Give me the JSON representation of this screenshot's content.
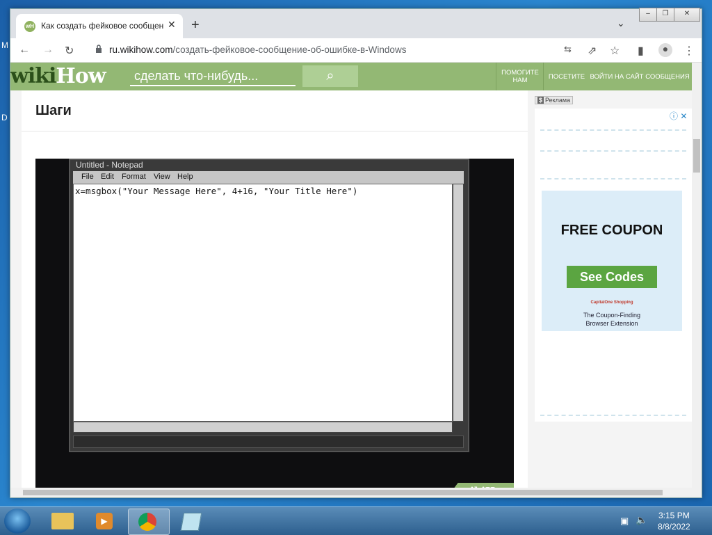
{
  "desktop": {
    "edge_top": "M",
    "edge_mid": "D"
  },
  "browser": {
    "tab_title": "Как создать фейковое сообщение",
    "tab_close": "✕",
    "new_tab": "+",
    "tab_search": "⌄",
    "window_controls": {
      "minimize": "–",
      "maximize": "❐",
      "close": "✕"
    },
    "url_host": "ru.wikihow.com",
    "url_path": "/создать-фейковое-сообщение-об-ошибке-в-Windows"
  },
  "wikihow": {
    "logo_wiki": "wiki",
    "logo_how": "How",
    "search_placeholder": "сделать что-нибудь...",
    "nav": [
      "ПОМОГИТЕ НАМ",
      "ПОСЕТИТЕ",
      "ВОЙТИ НА САЙТ",
      "СООБЩЕНИЯ"
    ],
    "section_title": "Шаги",
    "watermark": "wikiHow"
  },
  "notepad": {
    "title": "Untitled - Notepad",
    "menu": [
      "File",
      "Edit",
      "Format",
      "View",
      "Help"
    ],
    "content": "x=msgbox(\"Your Message Here\", 4+16, \"Your Title Here\")"
  },
  "ad": {
    "label_icon": "$",
    "label": "Реклама",
    "headline": "FREE COUPON",
    "cta": "See Codes",
    "brand": "CapitalOne Shopping",
    "tagline_1": "The Coupon-Finding",
    "tagline_2": "Browser Extension"
  },
  "taskbar": {
    "time": "3:15 PM",
    "date": "8/8/2022"
  },
  "colors": {
    "wikihow_green": "#93b874",
    "see_codes_green": "#5ba541"
  }
}
